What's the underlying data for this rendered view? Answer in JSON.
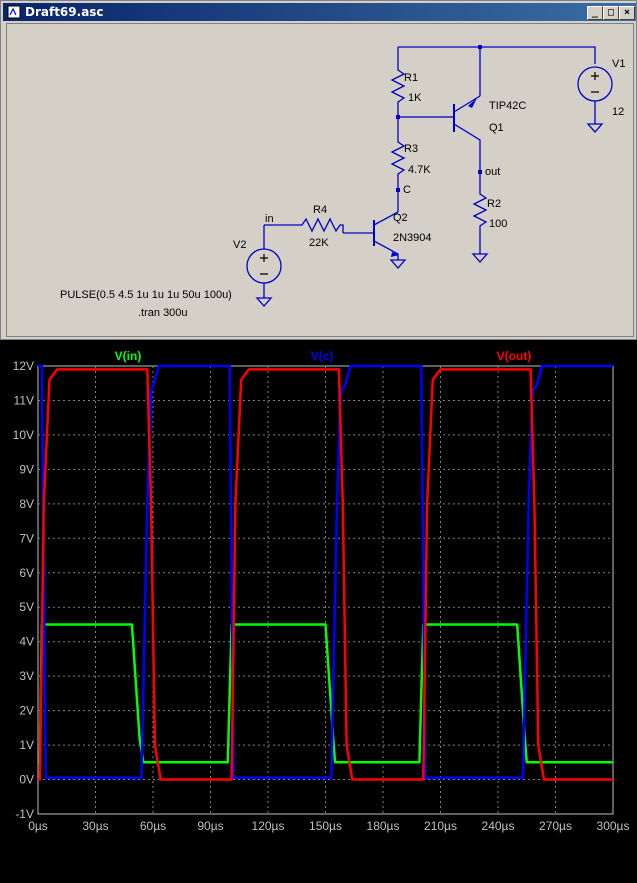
{
  "window": {
    "title": "Draft69.asc",
    "buttons": [
      "_",
      "□",
      "×"
    ]
  },
  "schematic": {
    "components": {
      "r1": {
        "name": "R1",
        "value": "1K"
      },
      "r2": {
        "name": "R2",
        "value": "100"
      },
      "r3": {
        "name": "R3",
        "value": "4.7K"
      },
      "r4": {
        "name": "R4",
        "value": "22K"
      },
      "q1": {
        "name": "Q1",
        "model": "TIP42C"
      },
      "q2": {
        "name": "Q2",
        "model": "2N3904"
      },
      "v1": {
        "name": "V1",
        "value": "12"
      },
      "v2": {
        "name": "V2"
      }
    },
    "nets": {
      "in": "in",
      "c": "C",
      "out": "out"
    },
    "directives": {
      "pulse": "PULSE(0.5 4.5 1u 1u 1u 50u 100u)",
      "tran": ".tran 300u"
    }
  },
  "plot": {
    "colors": {
      "in": "#00ff00",
      "c": "#0000ff",
      "out": "#ff0000",
      "grid": "#808080",
      "bg": "#000000"
    }
  },
  "chart_data": {
    "type": "line",
    "xlabel": "",
    "ylabel": "",
    "xlim": [
      0,
      300
    ],
    "ylim": [
      -1,
      12
    ],
    "xticks": [
      "0µs",
      "30µs",
      "60µs",
      "90µs",
      "120µs",
      "150µs",
      "180µs",
      "210µs",
      "240µs",
      "270µs",
      "300µs"
    ],
    "yticks": [
      "-1V",
      "0V",
      "1V",
      "2V",
      "3V",
      "4V",
      "5V",
      "6V",
      "7V",
      "8V",
      "9V",
      "10V",
      "11V",
      "12V"
    ],
    "legend_position": "top",
    "series": [
      {
        "name": "V(in)",
        "color": "#00ff00",
        "x": [
          0,
          1,
          2,
          49,
          53,
          55,
          99,
          100,
          101,
          102,
          150,
          154,
          155,
          199,
          200,
          201,
          202,
          250,
          254,
          255,
          300
        ],
        "y": [
          0.5,
          0.5,
          4.5,
          4.5,
          1.2,
          0.5,
          0.5,
          2.5,
          4.5,
          4.5,
          4.5,
          1.2,
          0.5,
          0.5,
          2.5,
          4.5,
          4.5,
          4.5,
          1.2,
          0.5,
          0.5
        ]
      },
      {
        "name": "V(c)",
        "color": "#0000ff",
        "x": [
          0,
          2,
          4,
          54,
          57,
          59,
          60,
          63,
          99,
          100,
          102,
          104,
          153,
          156,
          158,
          160,
          163,
          199,
          200,
          202,
          204,
          253,
          256,
          258,
          260,
          263,
          300
        ],
        "y": [
          12,
          12,
          0.05,
          0.05,
          8,
          11.3,
          11.4,
          12,
          12,
          12,
          0.05,
          0.05,
          0.05,
          8,
          11.3,
          11.4,
          12,
          12,
          12,
          0.05,
          0.05,
          0.05,
          8,
          11.3,
          11.4,
          12,
          12
        ]
      },
      {
        "name": "V(out)",
        "color": "#ff0000",
        "x": [
          0,
          1,
          3,
          6,
          10,
          57,
          59,
          61,
          64,
          100,
          101,
          103,
          106,
          110,
          157,
          159,
          161,
          164,
          200,
          201,
          203,
          206,
          210,
          257,
          259,
          261,
          264,
          300
        ],
        "y": [
          0,
          0,
          8,
          11.6,
          11.9,
          11.9,
          8,
          1,
          0,
          0,
          0,
          8,
          11.6,
          11.9,
          11.9,
          8,
          1,
          0,
          0,
          0,
          8,
          11.6,
          11.9,
          11.9,
          8,
          1,
          0,
          0
        ]
      }
    ]
  }
}
